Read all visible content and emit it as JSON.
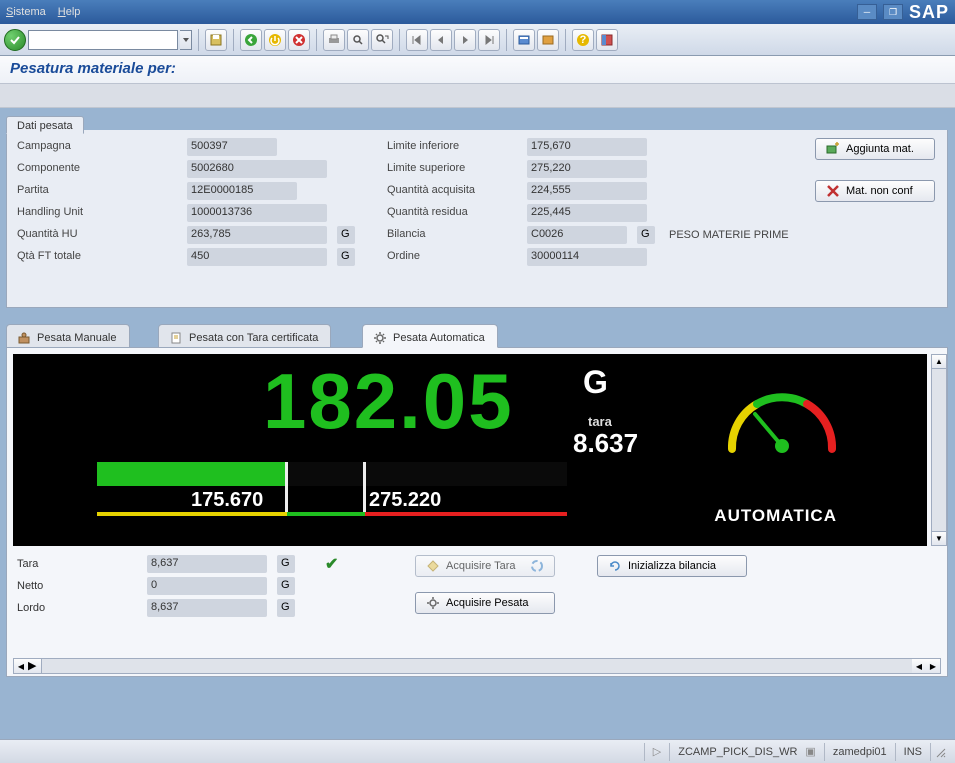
{
  "menu": {
    "sistema": "Sistema",
    "help": "Help"
  },
  "header": {
    "title": "Pesatura materiale per:"
  },
  "panel": {
    "tab_label": "Dati pesata",
    "campagna_l": "Campagna",
    "campagna_v": "500397",
    "componente_l": "Componente",
    "componente_v": "5002680",
    "partita_l": "Partita",
    "partita_v": "12E0000185",
    "hu_l": "Handling Unit",
    "hu_v": "1000013736",
    "qtahu_l": "Quantità HU",
    "qtahu_v": "263,785",
    "qtahu_u": "G",
    "qtaft_l": "Qtà FT totale",
    "qtaft_v": "450",
    "qtaft_u": "G",
    "liminf_l": "Limite inferiore",
    "liminf_v": "175,670",
    "limsup_l": "Limite superiore",
    "limsup_v": "275,220",
    "qacq_l": "Quantità acquisita",
    "qacq_v": "224,555",
    "qres_l": "Quantità residua",
    "qres_v": "225,445",
    "bil_l": "Bilancia",
    "bil_v": "C0026",
    "bil_u": "G",
    "bil_desc": "PESO MATERIE PRIME",
    "ord_l": "Ordine",
    "ord_v": "30000114",
    "btn_add": "Aggiunta mat.",
    "btn_nonconf": "Mat. non conf"
  },
  "tabs": {
    "manual": "Pesata  Manuale",
    "cert": "Pesata con Tara certificata",
    "auto": "Pesata  Automatica"
  },
  "display": {
    "weight": "182.05",
    "unit": "G",
    "tara_l": "tara",
    "tara_v": "8.637",
    "lim_low": "175.670",
    "lim_high": "275.220",
    "mode": "AUTOMATICA"
  },
  "lower": {
    "tara_l": "Tara",
    "tara_v": "8,637",
    "tara_u": "G",
    "netto_l": "Netto",
    "netto_v": "0",
    "netto_u": "G",
    "lordo_l": "Lordo",
    "lordo_v": "8,637",
    "lordo_u": "G",
    "btn_acq_tara": "Acquisire Tara",
    "btn_init": "Inizializza bilancia",
    "btn_acq_pes": "Acquisire Pesata"
  },
  "status": {
    "tcode": "ZCAMP_PICK_DIS_WR",
    "server": "zamedpi01",
    "mode": "INS"
  }
}
